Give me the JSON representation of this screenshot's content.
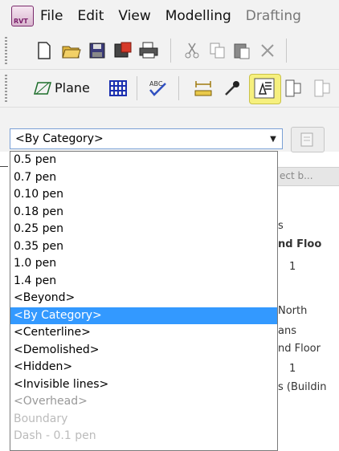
{
  "menubar": {
    "items": [
      "File",
      "Edit",
      "View",
      "Modelling",
      "Drafting"
    ]
  },
  "toolbar2": {
    "plane_label": "Plane"
  },
  "type_selector": {
    "value": "<By Category>"
  },
  "dropdown": {
    "options": [
      "0.5 pen",
      "0.7 pen",
      "0.10 pen",
      "0.18 pen",
      "0.25 pen",
      "0.35 pen",
      "1.0 pen",
      "1.4 pen",
      "<Beyond>",
      "<By Category>",
      "<Centerline>",
      "<Demolished>",
      "<Hidden>",
      "<Invisible lines>",
      "<Overhead>",
      "Boundary",
      "Dash - 0.1 pen"
    ],
    "selected": "<By Category>"
  },
  "background_panel": {
    "header": "ect b...",
    "lines": [
      "s",
      "nd Floo",
      "1",
      "North",
      "ans",
      "nd Floor",
      "1",
      "s (Buildin"
    ]
  },
  "colors": {
    "highlight": "#f6f07e",
    "selection": "#3399ff",
    "combo_border": "#7aa0d6"
  },
  "icons": [
    "app-rvt-icon",
    "new-icon",
    "open-icon",
    "save-icon",
    "save-special-icon",
    "print-icon",
    "cut-icon",
    "copy-icon",
    "paste-icon",
    "delete-icon",
    "plane-icon",
    "grid-icon",
    "spellcheck-icon",
    "measure-icon",
    "eyedropper-icon",
    "linework-icon",
    "door-icon"
  ]
}
